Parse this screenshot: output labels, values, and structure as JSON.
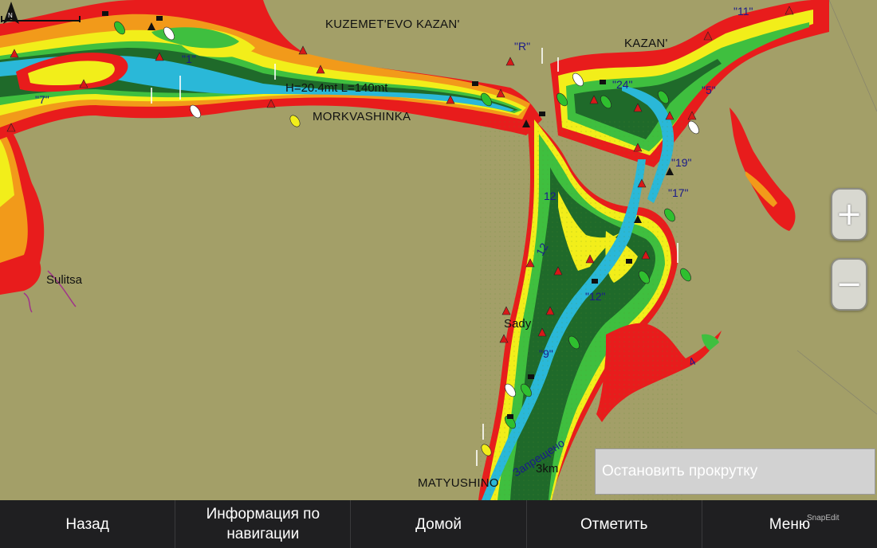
{
  "map": {
    "places": {
      "kuzemetevo_kazan": "KUZEMET'EVO  KAZAN'",
      "kazan": "KAZAN'",
      "morkvashinka": "MORKVASHINKA",
      "sulitsa": "Sulitsa",
      "sady": "Sady",
      "matyushino": "MATYUSHINO"
    },
    "bridge_label": "H=20.4mt L=140mt",
    "buoy_labels": {
      "b11": "\"11\"",
      "bR": "\"R\"",
      "b1": "\"1\"",
      "b7a": "\"7\"",
      "b24": "\"24\"",
      "b5": "\"5\"",
      "b19": "\"19\"",
      "b17": "\"17\"",
      "b12": "\"12\"",
      "b9": "\"9\""
    },
    "depths": {
      "d12a": "12",
      "d12b": "12",
      "d4": "4"
    },
    "restricted_text": "Запрещено",
    "scale": "3km",
    "north_icon": "north-arrow-icon"
  },
  "controls": {
    "zoom_in": "+",
    "zoom_out": "−",
    "stop_scroll": "Остановить прокрутку"
  },
  "nav": {
    "back": "Назад",
    "nav_info": "Информация по навигации",
    "home": "Домой",
    "mark": "Отметить",
    "menu": "Меню"
  },
  "watermark": "SnapEdit",
  "colors": {
    "land": "#a39f68",
    "deep": "#1f6a2a",
    "mid": "#3fbf3f",
    "shallow_yellow": "#f2ee1a",
    "shallow_orange": "#f29a1a",
    "shoal_red": "#e81c1c",
    "channel": "#2ab8d8"
  }
}
